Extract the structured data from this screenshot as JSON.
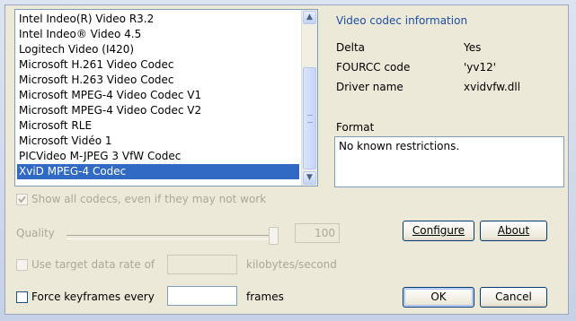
{
  "codec_list": {
    "items": [
      "Intel Indeo(R) Video R3.2",
      "Intel Indeo® Video 4.5",
      "Logitech Video (I420)",
      "Microsoft H.261 Video Codec",
      "Microsoft H.263 Video Codec",
      "Microsoft MPEG-4 Video Codec V1",
      "Microsoft MPEG-4 Video Codec V2",
      "Microsoft RLE",
      "Microsoft Vidéo 1",
      "PICVideo M-JPEG 3 VfW Codec",
      "XviD MPEG-4 Codec"
    ],
    "selected_index": 10
  },
  "info": {
    "title": "Video codec information",
    "rows": [
      {
        "label": "Delta",
        "value": "Yes"
      },
      {
        "label": "FOURCC code",
        "value": "'yv12'"
      },
      {
        "label": "Driver name",
        "value": "xvidvfw.dll"
      }
    ],
    "format_label": "Format",
    "format_text": "No known restrictions."
  },
  "options": {
    "show_all_label": "Show all codecs, even if they may not work",
    "show_all_checked": true,
    "quality_label": "Quality",
    "quality_value": "100",
    "quality_level": 1.0,
    "target_rate_label": "Use target data rate of",
    "target_rate_unit": "kilobytes/second",
    "target_rate_value": "",
    "keyframes_label": "Force keyframes every",
    "keyframes_value": "",
    "keyframes_unit": "frames"
  },
  "buttons": {
    "configure": "Configure",
    "about": "About",
    "ok": "OK",
    "cancel": "Cancel"
  }
}
